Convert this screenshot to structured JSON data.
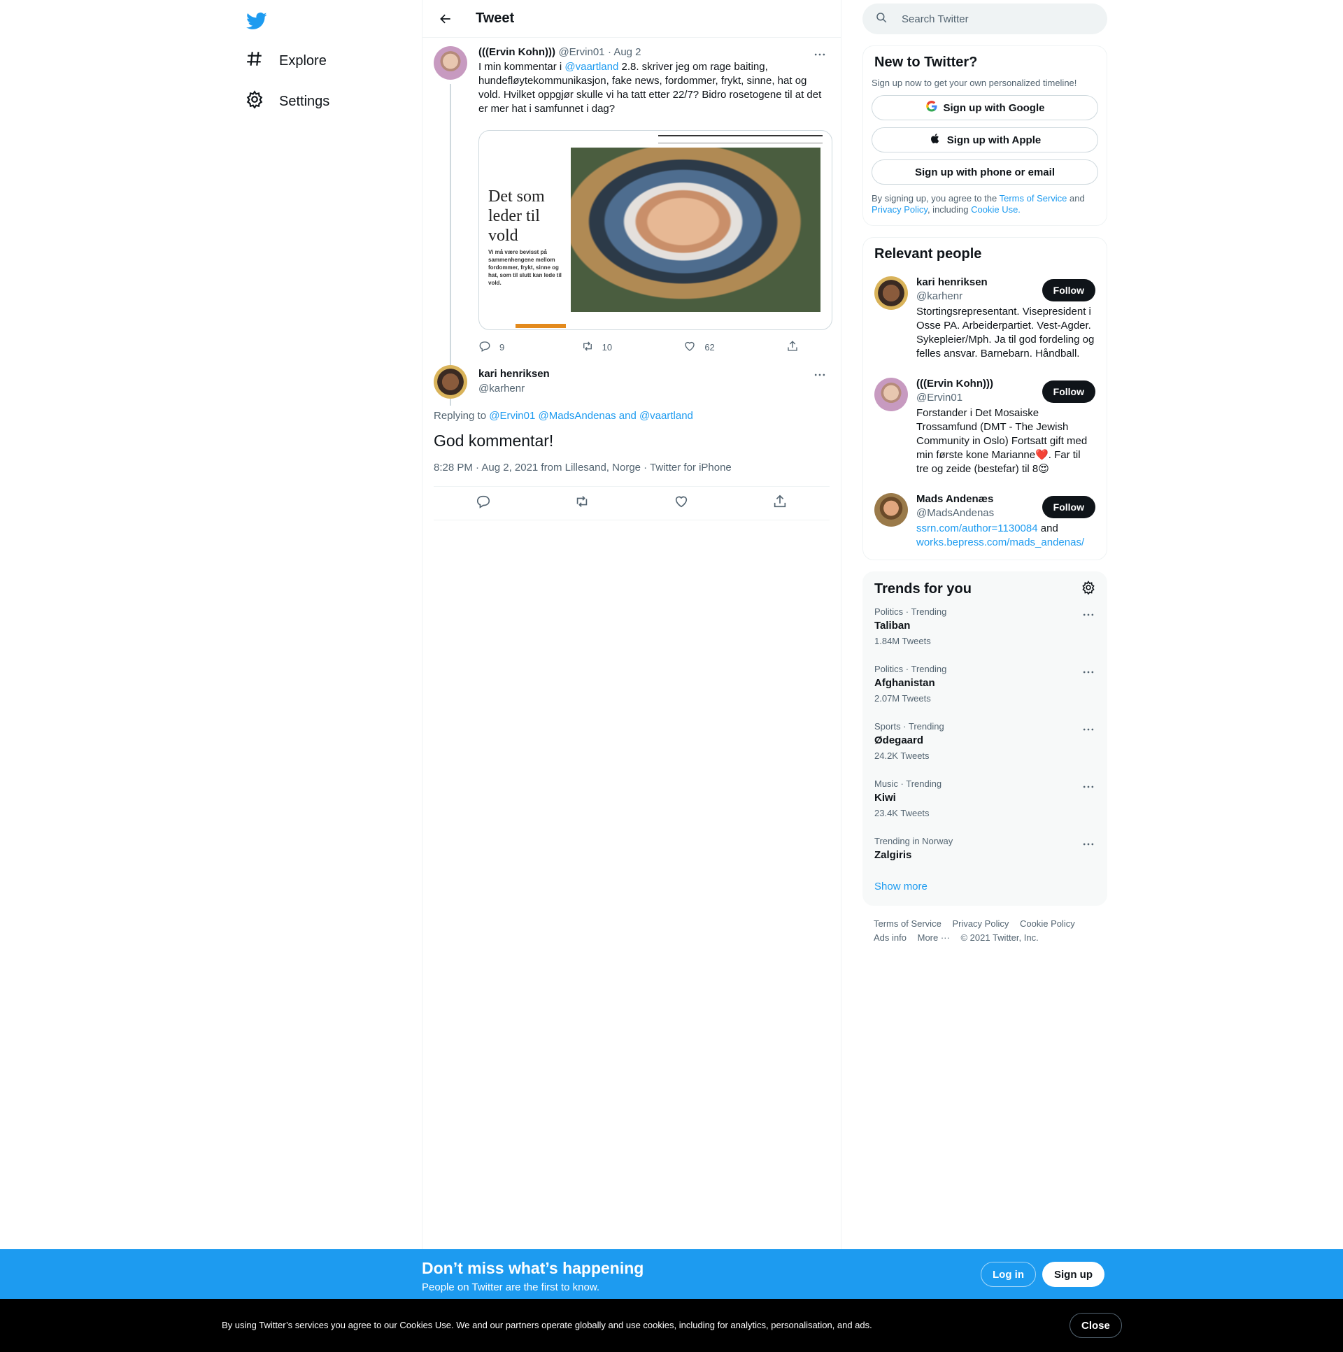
{
  "nav": {
    "explore_label": "Explore",
    "settings_label": "Settings",
    "logo_icon": "twitter-bird-icon",
    "brand_color": "#1d9bf0"
  },
  "header": {
    "title": "Tweet"
  },
  "search": {
    "placeholder": "Search Twitter"
  },
  "tweet": {
    "author_name": "(((Ervin Kohn)))",
    "author_handle": "@Ervin01",
    "date": "· Aug 2",
    "text_before": "I min kommentar i ",
    "mention": "@vaartland",
    "text_after": " 2.8. skriver jeg om rage baiting, hundefløytekommunikasjon, fake news, fordommer, frykt, sinne, hat og vold. Hvilket oppgjør skulle vi ha tatt etter 22/7? Bidro rosetogene til at det er mer hat i samfunnet i dag?",
    "media_headline": "Det som leder til vold",
    "media_sub": "Vi må være bevisst på sammenhengene mellom fordommer, frykt, sinne og hat, som til slutt kan lede til vold.",
    "reply_count": "9",
    "retweet_count": "10",
    "like_count": "62"
  },
  "reply": {
    "author_name": "kari henriksen",
    "author_handle": "@karhenr",
    "replying_label": "Replying to",
    "replying_users": "@Ervin01 @MadsAndenas and @vaartland",
    "text": "God kommentar!",
    "meta": "8:28 PM · Aug 2, 2021 from Lillesand, Norge · Twitter for iPhone"
  },
  "new_to_twitter": {
    "title": "New to Twitter?",
    "subtitle": "Sign up now to get your own personalized timeline!",
    "google": "Sign up with Google",
    "apple": "Sign up with Apple",
    "phone": "Sign up with phone or email",
    "terms_1": "By signing up, you agree to the ",
    "terms_link": "Terms of Service",
    "terms_2": " and ",
    "privacy_link": "Privacy Policy",
    "terms_3": ", including ",
    "cookie_link": "Cookie Use."
  },
  "relevant": {
    "title": "Relevant people",
    "people": [
      {
        "name": "kari henriksen",
        "handle": "@karhenr",
        "bio": "Stortingsrepresentant. Visepresident i Osse PA. Arbeiderpartiet. Vest-Agder. Sykepleier/Mph. Ja til god fordeling og felles ansvar. Barnebarn. Håndball.",
        "follow": "Follow"
      },
      {
        "name": "(((Ervin Kohn)))",
        "handle": "@Ervin01",
        "bio": "Forstander i Det Mosaiske Trossamfund (DMT - The Jewish Community in Oslo) Fortsatt gift med min første kone Marianne❤️. Far til tre og zeide (bestefar) til 8😍",
        "follow": "Follow"
      },
      {
        "name": "Mads Andenæs",
        "handle": "@MadsAndenas",
        "bio_link1": "ssrn.com/author=1130084",
        "bio_and": " and ",
        "bio_link2": "works.bepress.com/mads_andenas/",
        "follow": "Follow"
      }
    ]
  },
  "trends": {
    "title": "Trends for you",
    "items": [
      {
        "category": "Politics · Trending",
        "name": "Taliban",
        "count": "1.84M Tweets"
      },
      {
        "category": "Politics · Trending",
        "name": "Afghanistan",
        "count": "2.07M Tweets"
      },
      {
        "category": "Sports · Trending",
        "name": "Ødegaard",
        "count": "24.2K Tweets"
      },
      {
        "category": "Music · Trending",
        "name": "Kiwi",
        "count": "23.4K Tweets"
      },
      {
        "category": "Trending in Norway",
        "name": "Zalgiris",
        "count": ""
      }
    ],
    "show_more": "Show more"
  },
  "footer": {
    "terms": "Terms of Service",
    "privacy": "Privacy Policy",
    "cookie": "Cookie Policy",
    "ads": "Ads info",
    "more": "More ···",
    "copyright": "© 2021 Twitter, Inc."
  },
  "banner": {
    "title": "Don’t miss what’s happening",
    "subtitle": "People on Twitter are the first to know.",
    "login": "Log in",
    "signup": "Sign up"
  },
  "cookie": {
    "text": "By using Twitter’s services you agree to our Cookies Use. We and our partners operate globally and use cookies, including for analytics, personalisation, and ads.",
    "close": "Close"
  }
}
